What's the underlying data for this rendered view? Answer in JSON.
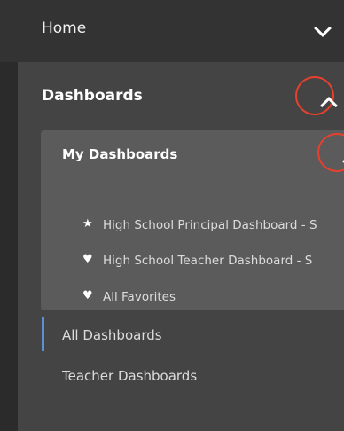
{
  "home": {
    "label": "Home"
  },
  "dashboards": {
    "title": "Dashboards",
    "my_dashboards": {
      "title": "My Dashboards",
      "items": [
        {
          "icon": "star-icon",
          "glyph": "★",
          "label": "High School Principal Dashboard - S"
        },
        {
          "icon": "heart-icon",
          "glyph": "♥",
          "label": "High School Teacher Dashboard - S"
        },
        {
          "icon": "heart-icon",
          "glyph": "♥",
          "label": "All Favorites"
        }
      ]
    },
    "nav": [
      {
        "label": "All Dashboards",
        "active": true
      },
      {
        "label": "Teacher Dashboards",
        "active": false
      }
    ]
  },
  "colors": {
    "background": "#2b2b2b",
    "panel": "#444444",
    "subpanel": "#5b5b5b",
    "highlight_circle": "#e8402c",
    "active_indicator": "#5b8fd6"
  }
}
